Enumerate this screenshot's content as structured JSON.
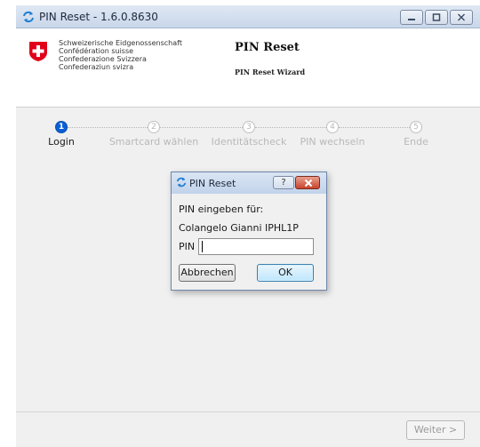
{
  "window": {
    "title": "PIN Reset - 1.6.0.8630"
  },
  "header": {
    "gov_lines": [
      "Schweizerische Eidgenossenschaft",
      "Confédération suisse",
      "Confederazione Svizzera",
      "Confederaziun svizra"
    ],
    "title": "PIN Reset",
    "subtitle": "PIN Reset Wizard"
  },
  "steps": [
    {
      "number": "1",
      "label": "Login",
      "active": true
    },
    {
      "number": "2",
      "label": "Smartcard wählen",
      "active": false
    },
    {
      "number": "3",
      "label": "Identitätscheck",
      "active": false
    },
    {
      "number": "4",
      "label": "PIN wechseln",
      "active": false
    },
    {
      "number": "5",
      "label": "Ende",
      "active": false
    }
  ],
  "footer": {
    "next_label": "Weiter >"
  },
  "dialog": {
    "title": "PIN Reset",
    "help_label": "?",
    "prompt": "PIN eingeben für:",
    "user": "Colangelo Gianni IPHL1P",
    "pin_label": "PIN",
    "pin_value": "",
    "cancel_label": "Abbrechen",
    "ok_label": "OK"
  },
  "icons": {
    "app": "refresh-arrows-icon",
    "flag": "swiss-cross-icon",
    "minimize": "minimize-icon",
    "maximize": "maximize-icon",
    "close": "close-icon"
  },
  "colors": {
    "active_step": "#0b5fd6",
    "flag_red": "#e1001a",
    "close_red": "#c8432b"
  }
}
